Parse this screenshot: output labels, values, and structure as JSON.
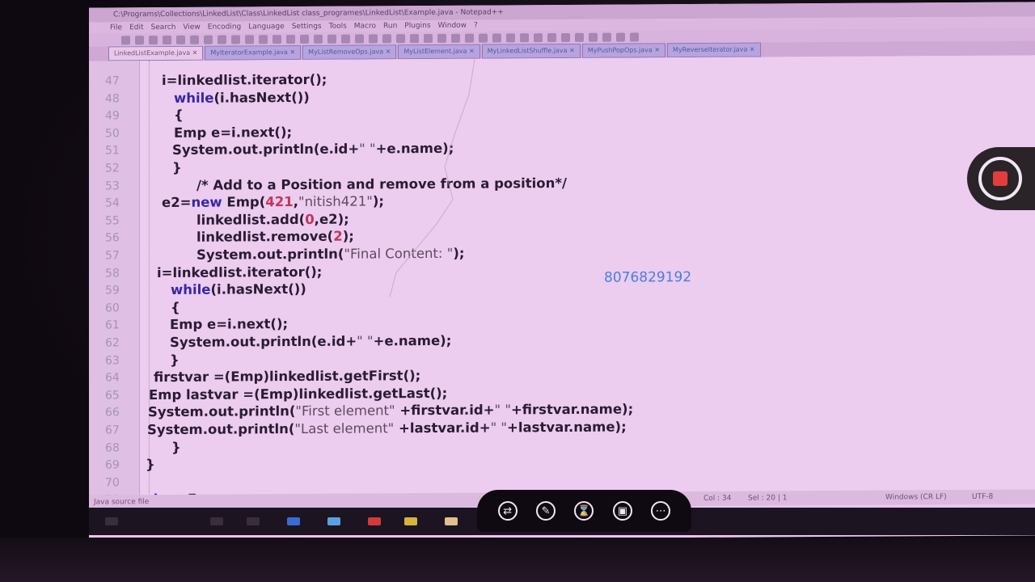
{
  "window": {
    "title": "C:\\Programs\\Collections\\LinkedList\\Class\\LinkedList class_programes\\LinkedList\\Example.java - Notepad++"
  },
  "menubar": {
    "items": [
      "File",
      "Edit",
      "Search",
      "View",
      "Encoding",
      "Language",
      "Settings",
      "Tools",
      "Macro",
      "Run",
      "Plugins",
      "Window",
      "?"
    ]
  },
  "tabs": [
    {
      "label": "LinkedListExample.java",
      "active": true
    },
    {
      "label": "MyIteratorExample.java",
      "active": false
    },
    {
      "label": "MyListRemoveOps.java",
      "active": false
    },
    {
      "label": "MyListElement.java",
      "active": false
    },
    {
      "label": "MyLinkedListShuffle.java",
      "active": false
    },
    {
      "label": "MyPushPopOps.java",
      "active": false
    },
    {
      "label": "MyReverseIterator.java",
      "active": false
    }
  ],
  "code_lines": [
    {
      "n": "47",
      "indent": 90,
      "html": "i=linkedlist.iterator();"
    },
    {
      "n": "48",
      "indent": 105,
      "html": "<span class=\"kw\">while</span>(i.hasNext())"
    },
    {
      "n": "49",
      "indent": 105,
      "html": "{"
    },
    {
      "n": "50",
      "indent": 105,
      "html": "Emp e=i.next();"
    },
    {
      "n": "51",
      "indent": 103,
      "html": "System.out.println(e.id+<span class=\"str\">\" \"</span>+e.name);"
    },
    {
      "n": "52",
      "indent": 103,
      "html": "}"
    },
    {
      "n": "53",
      "indent": 133,
      "html": "<span class=\"comment\">/* Add to a Position and remove from a position*/</span>"
    },
    {
      "n": "54",
      "indent": 90,
      "html": "e2=<span class=\"kw\">new</span> Emp(<span class=\"num\">421</span>,<span class=\"str\">\"nitish421\"</span>);"
    },
    {
      "n": "55",
      "indent": 133,
      "html": "linkedlist.add(<span class=\"num\">0</span>,e2);"
    },
    {
      "n": "56",
      "indent": 133,
      "html": "linkedlist.remove(<span class=\"num\">2</span>);"
    },
    {
      "n": "57",
      "indent": 133,
      "html": "System.out.println(<span class=\"str\">\"Final Content: \"</span>);"
    },
    {
      "n": "58",
      "indent": 84,
      "html": "i=linkedlist.iterator();"
    },
    {
      "n": "59",
      "indent": 101,
      "html": "<span class=\"kw\">while</span>(i.hasNext())"
    },
    {
      "n": "60",
      "indent": 101,
      "html": "{"
    },
    {
      "n": "61",
      "indent": 100,
      "html": "Emp e=i.next();"
    },
    {
      "n": "62",
      "indent": 100,
      "html": "System.out.println(e.id+<span class=\"str\">\" \"</span>+e.name);"
    },
    {
      "n": "63",
      "indent": 100,
      "html": "}"
    },
    {
      "n": "64",
      "indent": 80,
      "html": "firstvar =(Emp)linkedlist.getFirst();"
    },
    {
      "n": "65",
      "indent": 74,
      "html": "Emp lastvar =(Emp)linkedlist.getLast();"
    },
    {
      "n": "66",
      "indent": 73,
      "html": "System.out.println(<span class=\"str\">\"First element\"</span> +firstvar.id+<span class=\"str\">\" \"</span>+firstvar.name);"
    },
    {
      "n": "67",
      "indent": 72,
      "html": "System.out.println(<span class=\"str\">\"Last element\"</span> +lastvar.id+<span class=\"str\">\" \"</span>+lastvar.name);"
    },
    {
      "n": "68",
      "indent": 102,
      "html": "}"
    },
    {
      "n": "69",
      "indent": 70,
      "html": "}"
    },
    {
      "n": "70",
      "indent": 70,
      "html": ""
    },
    {
      "n": "71",
      "indent": 70,
      "html": "<span class=\"kw\">class</span> Emp"
    }
  ],
  "overlay_text": "8076829192",
  "statusbar": {
    "left": "Java source file",
    "col": "Col : 34",
    "sel": "Sel : 20 | 1",
    "eol": "Windows (CR LF)",
    "encoding": "UTF-8"
  },
  "overlay_toolbar": {
    "buttons": [
      {
        "name": "swap-icon",
        "glyph": "⇄"
      },
      {
        "name": "brush-icon",
        "glyph": "✎"
      },
      {
        "name": "hourglass-icon",
        "glyph": "⌛"
      },
      {
        "name": "image-icon",
        "glyph": "▣"
      },
      {
        "name": "more-icon",
        "glyph": "⋯"
      }
    ]
  },
  "colors": {
    "keyword": "#3527a8",
    "number": "#c0365a",
    "phone": "#4a7fe0",
    "record": "#e23d3d"
  }
}
